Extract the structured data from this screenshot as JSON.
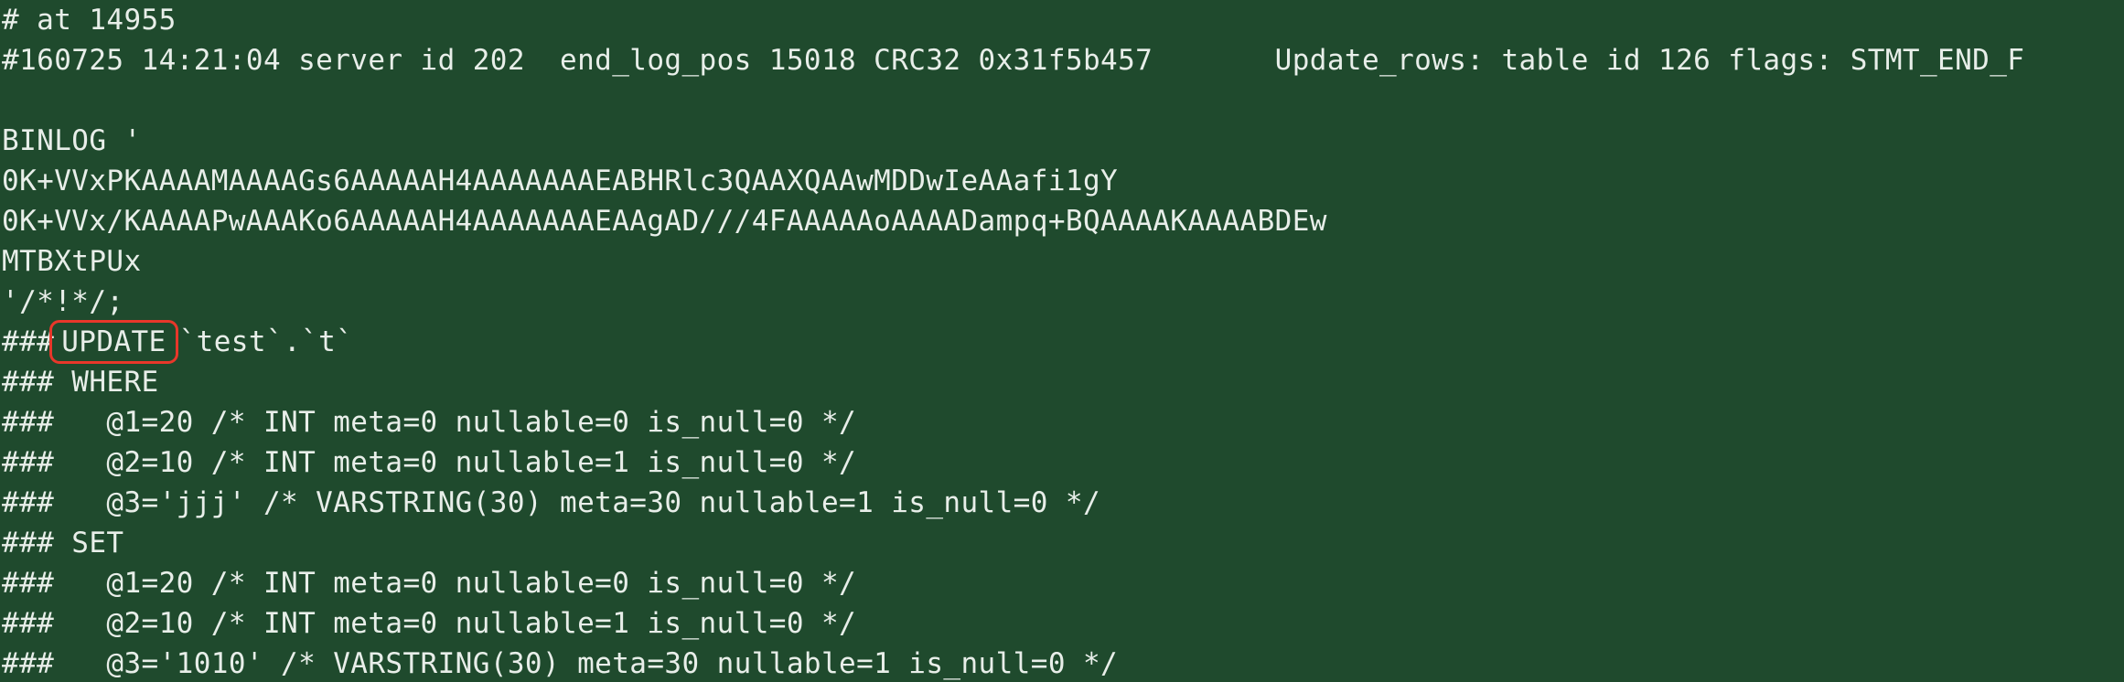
{
  "terminal": {
    "background": "#1f4a2d",
    "foreground": "#e8eee9",
    "highlight_color": "#e8372a",
    "lines": {
      "l0": "# at 14955",
      "l1": "#160725 14:21:04 server id 202  end_log_pos 15018 CRC32 0x31f5b457       Update_rows: table id 126 flags: STMT_END_F",
      "l2": "",
      "l3": "BINLOG '",
      "l4": "0K+VVxPKAAAAMAAAAGs6AAAAAH4AAAAAAAEABHRlc3QAAXQAAwMDDwIeAAafi1gY",
      "l5": "0K+VVx/KAAAAPwAAAKo6AAAAAH4AAAAAAAEAAgAD///4FAAAAAoAAAADampq+BQAAAAKAAAABDEw",
      "l6": "MTBXtPUx",
      "l7": "'/*!*/;",
      "l8_prefix": "###",
      "l8_highlight": "UPDATE",
      "l8_suffix": "`test`.`t`",
      "l9": "### WHERE",
      "l10": "###   @1=20 /* INT meta=0 nullable=0 is_null=0 */",
      "l11": "###   @2=10 /* INT meta=0 nullable=1 is_null=0 */",
      "l12": "###   @3='jjj' /* VARSTRING(30) meta=30 nullable=1 is_null=0 */",
      "l13": "### SET",
      "l14": "###   @1=20 /* INT meta=0 nullable=0 is_null=0 */",
      "l15": "###   @2=10 /* INT meta=0 nullable=1 is_null=0 */",
      "l16": "###   @3='1010' /* VARSTRING(30) meta=30 nullable=1 is_null=0 */"
    }
  }
}
